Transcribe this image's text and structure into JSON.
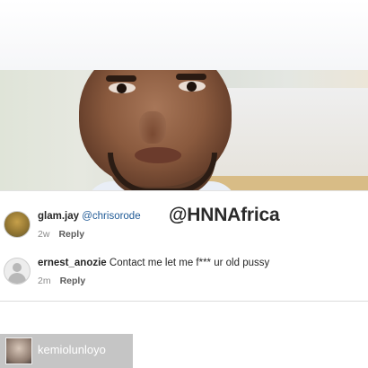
{
  "watermark": "@HNNAfrica",
  "comments": [
    {
      "username": "glam.jay",
      "text": "@chrisorode",
      "time": "2w",
      "reply_label": "Reply"
    },
    {
      "username": "ernest_anozie",
      "text": "Contact me let me f*** ur old pussy",
      "time": "2m",
      "reply_label": "Reply"
    }
  ],
  "repost": {
    "username": "kemiolunloyo"
  }
}
